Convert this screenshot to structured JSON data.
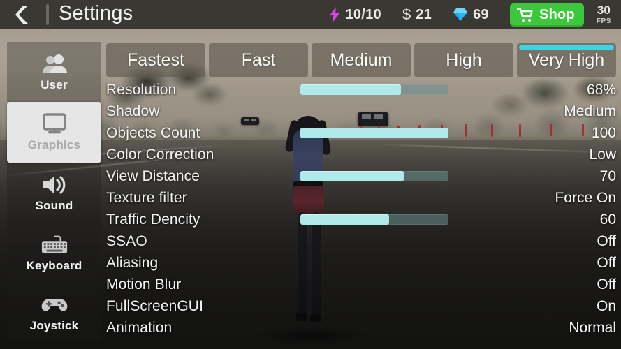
{
  "topbar": {
    "back_icon": "chevron-left-icon",
    "title": "Settings",
    "energy": {
      "icon": "lightning-bolt-icon",
      "value": "10/10",
      "color": "#e040f0"
    },
    "money": {
      "icon": "dollar-sign-icon",
      "symbol": "$",
      "value": "21"
    },
    "gems": {
      "icon": "diamond-icon",
      "value": "69",
      "color": "#29b6f6"
    },
    "shop": {
      "icon": "shopping-cart-icon",
      "label": "Shop",
      "color": "#3cc83c"
    },
    "fps": {
      "value": "30",
      "label": "FPS"
    }
  },
  "sidebar": {
    "items": [
      {
        "label": "User",
        "icon": "users-icon",
        "active": false
      },
      {
        "label": "Graphics",
        "icon": "monitor-icon",
        "active": true
      },
      {
        "label": "Sound",
        "icon": "speaker-icon",
        "active": false
      },
      {
        "label": "Keyboard",
        "icon": "keyboard-icon",
        "active": false
      },
      {
        "label": "Joystick",
        "icon": "gamepad-icon",
        "active": false
      }
    ]
  },
  "presets": {
    "selected": "Very High",
    "selected_color": "#3ed4e8",
    "items": [
      {
        "label": "Fastest",
        "selected": false
      },
      {
        "label": "Fast",
        "selected": false
      },
      {
        "label": "Medium",
        "selected": false
      },
      {
        "label": "High",
        "selected": false
      },
      {
        "label": "Very High",
        "selected": true
      }
    ]
  },
  "settings": {
    "slider_fill_color": "#aeeaea",
    "rows": [
      {
        "label": "Resolution",
        "value": "68%",
        "type": "slider",
        "percent": 68
      },
      {
        "label": "Shadow",
        "value": "Medium",
        "type": "text"
      },
      {
        "label": "Objects Count",
        "value": "100",
        "type": "slider",
        "percent": 100
      },
      {
        "label": "Color Correction",
        "value": "Low",
        "type": "text"
      },
      {
        "label": "View Distance",
        "value": "70",
        "type": "slider",
        "percent": 70
      },
      {
        "label": "Texture filter",
        "value": "Force On",
        "type": "text"
      },
      {
        "label": "Traffic Dencity",
        "value": "60",
        "type": "slider",
        "percent": 60
      },
      {
        "label": "SSAO",
        "value": "Off",
        "type": "text"
      },
      {
        "label": "Aliasing",
        "value": "Off",
        "type": "text"
      },
      {
        "label": "Motion Blur",
        "value": "Off",
        "type": "text"
      },
      {
        "label": "FullScreenGUI",
        "value": "On",
        "type": "text"
      },
      {
        "label": "Animation",
        "value": "Normal",
        "type": "text"
      }
    ]
  }
}
